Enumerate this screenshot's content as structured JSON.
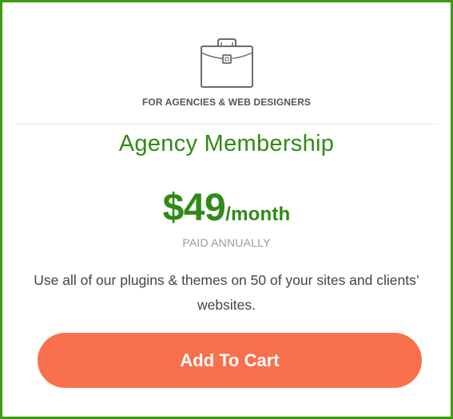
{
  "plan": {
    "icon": "briefcase-icon",
    "audience": "FOR AGENCIES & WEB DESIGNERS",
    "title": "Agency Membership",
    "price": "$49",
    "period": "/month",
    "billing_note": "PAID ANNUALLY",
    "description": "Use all of our plugins & themes on 50 of your sites and clients’ websites.",
    "cta_label": "Add To Cart"
  },
  "colors": {
    "border": "#3d9b12",
    "title": "#2f8a16",
    "price": "#2f8a16",
    "cta_background": "#f9704d",
    "cta_text": "#ffffff",
    "icon_stroke": "#6b6b6b"
  }
}
